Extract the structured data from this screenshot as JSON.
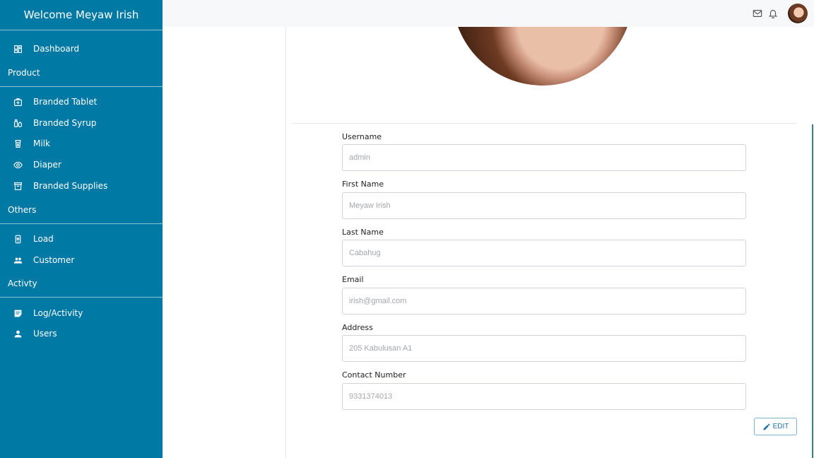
{
  "sidebar": {
    "welcome": "Welcome  Meyaw Irish",
    "dashboard": "Dashboard",
    "sections": {
      "product": "Product",
      "others": "Others",
      "activity": "Activty"
    },
    "product_items": [
      {
        "label": "Branded Tablet",
        "icon": "medical-bag-icon"
      },
      {
        "label": "Branded Syrup",
        "icon": "syrup-icon"
      },
      {
        "label": "Milk",
        "icon": "milk-icon"
      },
      {
        "label": "Diaper",
        "icon": "eye-icon"
      },
      {
        "label": "Branded Supplies",
        "icon": "archive-icon"
      }
    ],
    "other_items": [
      {
        "label": "Load",
        "icon": "phone-load-icon"
      },
      {
        "label": "Customer",
        "icon": "people-icon"
      }
    ],
    "activity_items": [
      {
        "label": "Log/Activity",
        "icon": "note-icon"
      },
      {
        "label": "Users",
        "icon": "user-icon"
      }
    ]
  },
  "topbar": {
    "icons": [
      "mail-icon",
      "bell-icon",
      "avatar"
    ]
  },
  "form": {
    "fields": [
      {
        "label": "Username",
        "value": "admin"
      },
      {
        "label": "First Name",
        "value": "Meyaw Irish"
      },
      {
        "label": "Last Name",
        "value": "Cabahug"
      },
      {
        "label": "Email",
        "value": "irish@gmail.com"
      },
      {
        "label": "Address",
        "value": "205 Kabulusan A1"
      },
      {
        "label": "Contact Number",
        "value": "9331374013"
      }
    ],
    "edit_label": "EDIT"
  },
  "colors": {
    "sidebar": "#0079a4",
    "accent": "#1f74a8"
  }
}
